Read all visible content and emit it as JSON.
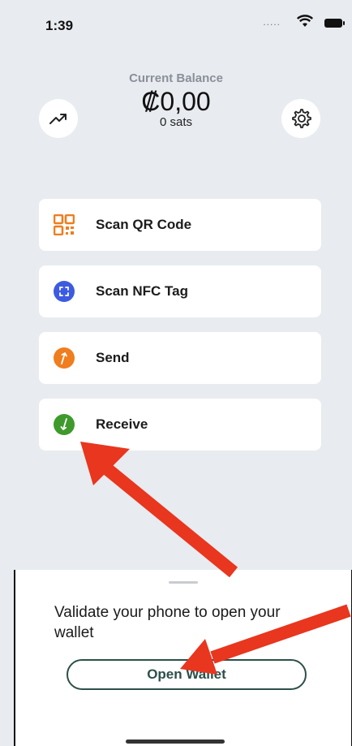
{
  "status_bar": {
    "time": "1:39",
    "dots": "....."
  },
  "balance": {
    "label": "Current Balance",
    "amount": "₡0,00",
    "sats": "0 sats"
  },
  "actions": [
    {
      "label": "Scan QR Code",
      "icon": "qr-code-icon",
      "color": "#f07d1e"
    },
    {
      "label": "Scan NFC Tag",
      "icon": "nfc-scan-icon",
      "color": "#3d5be0"
    },
    {
      "label": "Send",
      "icon": "send-arrow-icon",
      "color": "#f07d1e"
    },
    {
      "label": "Receive",
      "icon": "receive-arrow-icon",
      "color": "#3f9a2c"
    }
  ],
  "sheet": {
    "message": "Validate your phone to open your wallet",
    "button_label": "Open Wallet"
  },
  "colors": {
    "background": "#e8ebef",
    "accent_dark_green": "#2d4f49",
    "annotation_red": "#e8361f"
  }
}
